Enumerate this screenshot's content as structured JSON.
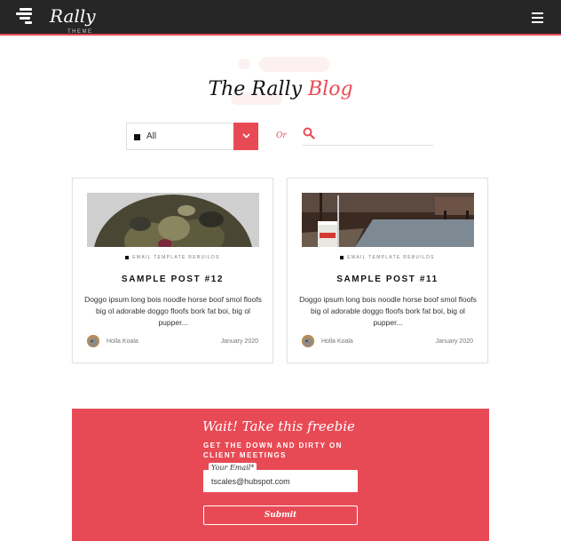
{
  "header": {
    "logo_text": "Rally",
    "logo_sub": "THEME",
    "menu_icon": "hamburger-menu-icon"
  },
  "hero": {
    "title_prefix": "The Rally",
    "title_accent": "Blog"
  },
  "filters": {
    "select_value": "All",
    "select_icon": "chevron-down-icon",
    "or_label": "Or",
    "search_icon": "search-icon",
    "search_placeholder": ""
  },
  "posts": [
    {
      "category": "EMAIL TEMPLATE REBUILDS",
      "title": "SAMPLE POST #12",
      "excerpt": "Doggo ipsum long bois noodle horse boof smol floofs big ol adorable doggo floofs bork fat boi, big ol pupper...",
      "author": "Holla Koala",
      "date": "January 2020"
    },
    {
      "category": "EMAIL TEMPLATE REBUILDS",
      "title": "SAMPLE POST #11",
      "excerpt": "Doggo ipsum long bois noodle horse boof smol floofs big ol adorable doggo floofs bork fat boi, big ol pupper...",
      "author": "Holla Koala",
      "date": "January 2020"
    }
  ],
  "freebie": {
    "title": "Wait! Take this freebie",
    "subtitle": "GET THE DOWN AND DIRTY ON CLIENT MEETINGS",
    "email_label": "Your Email*",
    "email_value": "tscales@hubspot.com",
    "submit_label": "Submit"
  },
  "colors": {
    "accent": "#e84a55",
    "topbar": "#262626"
  }
}
